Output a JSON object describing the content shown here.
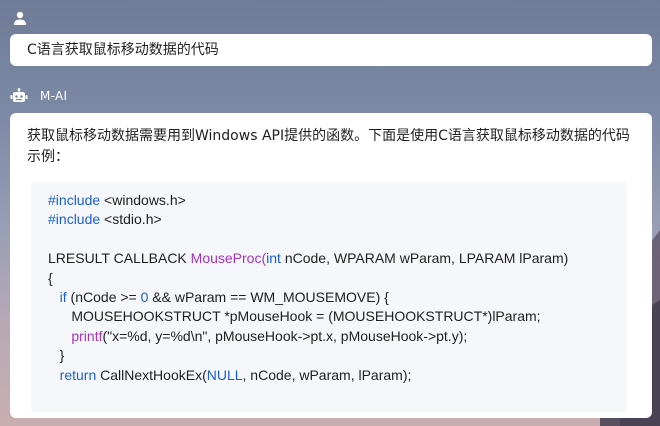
{
  "user_message": {
    "avatar_icon": "user-icon",
    "text": "C语言获取鼠标移动数据的代码"
  },
  "assistant": {
    "avatar_icon": "robot-icon",
    "name": "M-AI",
    "intro": "获取鼠标移动数据需要用到Windows   API提供的函数。下面是使用C语言获取鼠标移动数据的代码示例：",
    "code": {
      "l1": {
        "hash": "#",
        "kw": "include",
        "rest": " <windows.h>"
      },
      "l2": {
        "hash": "#",
        "kw": "include",
        "rest": " <stdio.h>"
      },
      "l4": {
        "a": "LRESULT CALLBACK ",
        "fn": "MouseProc",
        "b": "(",
        "kw": "int",
        "c": " nCode, WPARAM wParam, LPARAM lParam)"
      },
      "l5": "{",
      "l6": {
        "indent": "   ",
        "kw": "if",
        "a": " (nCode >= ",
        "num": "0",
        "b": " && wParam == WM_MOUSEMOVE) {"
      },
      "l7": "      MOUSEHOOKSTRUCT *pMouseHook = (MOUSEHOOKSTRUCT*)lParam;",
      "l8": {
        "indent": "      ",
        "fn": "printf",
        "a": "(\"x=%d, y=%d\\n\", pMouseHook->pt.x, pMouseHook->pt.y);"
      },
      "l9": "   }",
      "l10": {
        "indent": "   ",
        "kw": "return",
        "a": " CallNextHookEx(",
        "kw2": "NULL",
        "b": ", nCode, wParam, lParam);"
      }
    }
  },
  "colors": {
    "keyword": "#1a5fd0",
    "function": "#a533b8",
    "text": "#1f1f1f"
  }
}
